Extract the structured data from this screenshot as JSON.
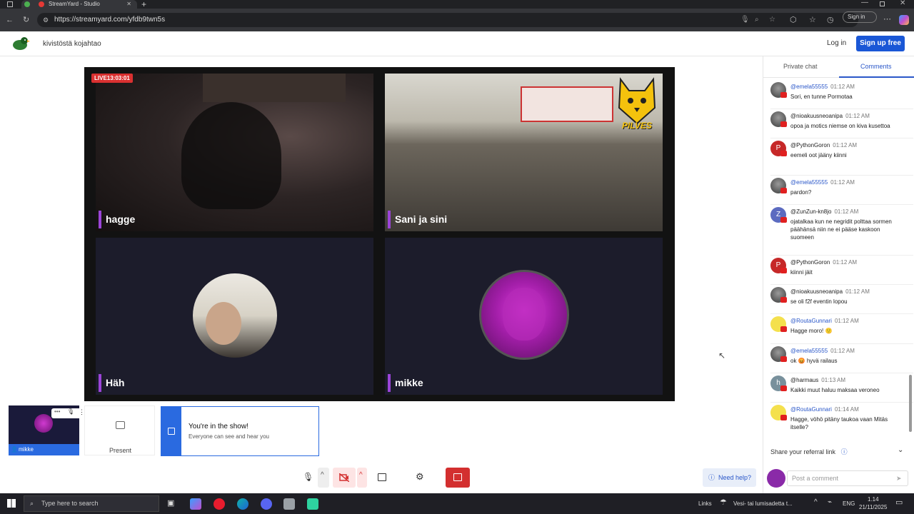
{
  "browser": {
    "tab_title": "StreamYard - Studio",
    "url": "https://streamyard.com/yfdb9twn5s",
    "signin_label": "Sign in"
  },
  "header": {
    "broadcast_title": "kivistöstä kojahtao",
    "login_label": "Log in",
    "signup_label": "Sign up free"
  },
  "stage": {
    "live_badge": "LIVE13:03:01",
    "tiles": [
      {
        "name": "hagge"
      },
      {
        "name": "Sani ja sini"
      },
      {
        "name": "Häh"
      },
      {
        "name": "mikke"
      }
    ],
    "logo_text": "PILVES"
  },
  "self_view": {
    "name": "mikke"
  },
  "present": {
    "label": "Present"
  },
  "toast": {
    "title": "You're in the show!",
    "subtitle": "Everyone can see and hear you"
  },
  "help": {
    "label": "Need help?"
  },
  "sidebar": {
    "tabs": [
      "Private chat",
      "Comments"
    ],
    "active_tab": "Comments",
    "comments": [
      {
        "user": "@emela55555",
        "time": "01:12 AM",
        "text": "Sori, en tunne Pormotaa",
        "avatar": "photo",
        "blue": true
      },
      {
        "user": "@nioakuusneoanipa",
        "time": "01:12 AM",
        "text": "opoa ja motics niemse on kiva kusettoa",
        "avatar": "photo",
        "blue": false
      },
      {
        "user": "@PythonGoron",
        "time": "01:12 AM",
        "text": "eemeli oot jääny kiinni",
        "avatar": "P",
        "color": "#c62828",
        "blue": false
      },
      {
        "user": "@emela55555",
        "time": "01:12 AM",
        "text": "pardon?",
        "avatar": "photo",
        "blue": true
      },
      {
        "user": "@ZunZun-kn8jo",
        "time": "01:12 AM",
        "text": "ojatalkaa kun ne negridit polttaa sormen päähänsä niin ne ei pääse kaskoon suomeen",
        "avatar": "Z",
        "color": "#5c6bc0",
        "blue": false
      },
      {
        "user": "@PythonGoron",
        "time": "01:12 AM",
        "text": "kiinni jäit",
        "avatar": "P",
        "color": "#c62828",
        "blue": false
      },
      {
        "user": "@nioakuusneoanipa",
        "time": "01:12 AM",
        "text": "se oli f2f eventin lopou",
        "avatar": "photo",
        "blue": false
      },
      {
        "user": "@RoutaGunnari",
        "time": "01:12 AM",
        "text": "Hagge moro! 🙂",
        "avatar": "yellow",
        "blue": true
      },
      {
        "user": "@emela55555",
        "time": "01:12 AM",
        "text": "ok 😡 hyvä railaus",
        "avatar": "photo",
        "blue": true
      },
      {
        "user": "@harmaus",
        "time": "01:13 AM",
        "text": "Kaikki muut haluu maksaa veroneo",
        "avatar": "h",
        "color": "#78909c",
        "blue": false
      },
      {
        "user": "@RoutaGunnari",
        "time": "01:14 AM",
        "text": "Hagge, vöhö pitäny taukoa vaan Mitäs itselle?",
        "avatar": "yellow",
        "blue": true
      }
    ],
    "referral_label": "Share your referral link",
    "post_placeholder": "Post a comment"
  },
  "taskbar": {
    "search_placeholder": "Type here to search",
    "links_label": "Links",
    "weather": "Vesi- tai lumisadetta t...",
    "language": "ENG",
    "time": "1.14",
    "date": "21/11/2025"
  }
}
